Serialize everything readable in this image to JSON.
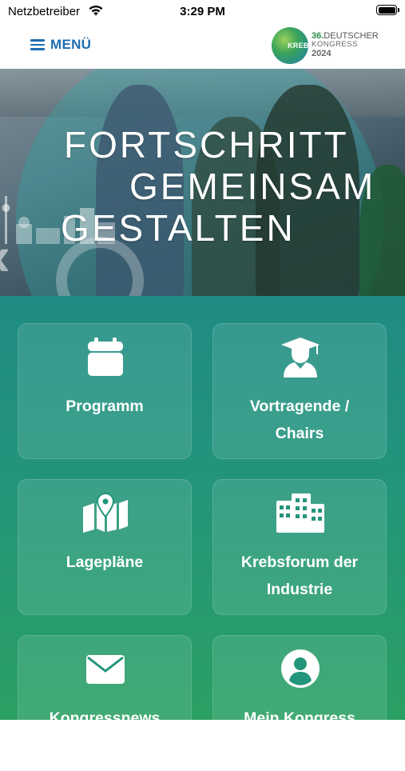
{
  "status_bar": {
    "carrier": "Netzbetreiber",
    "time": "3:29 PM"
  },
  "header": {
    "menu_label": "MENÜ",
    "logo": {
      "number": "36.",
      "line1": "DEUTSCHER",
      "krebs": "KREBS",
      "line2": "KONGRESS",
      "year": "2024"
    }
  },
  "hero": {
    "lines": [
      "FORTSCHRITT",
      "GEMEINSAM",
      "GESTALTEN"
    ]
  },
  "tiles": [
    {
      "label_lines": [
        "Programm"
      ],
      "icon": "calendar-icon"
    },
    {
      "label_lines": [
        "Vortragende /",
        "Chairs"
      ],
      "icon": "graduate-icon"
    },
    {
      "label_lines": [
        "Lagepläne"
      ],
      "icon": "map-icon"
    },
    {
      "label_lines": [
        "Krebsforum der",
        "Industrie"
      ],
      "icon": "building-icon"
    },
    {
      "label_lines": [
        "Kongressnews"
      ],
      "icon": "envelope-icon"
    },
    {
      "label_lines": [
        "Mein Kongress"
      ],
      "icon": "user-icon"
    }
  ],
  "colors": {
    "accent": "#1c6db0",
    "tile_bg_top": "#1f8c83",
    "tile_bg_bottom": "#2aa063"
  }
}
